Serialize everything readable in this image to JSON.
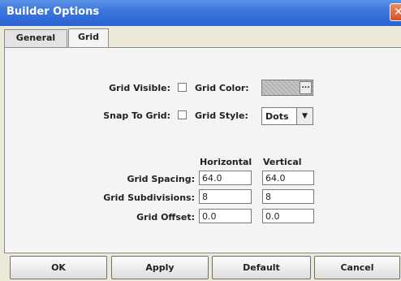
{
  "window": {
    "title": "Builder Options",
    "close_glyph": "✕"
  },
  "tabs": [
    {
      "label": "General",
      "selected": false
    },
    {
      "label": "Grid",
      "selected": true
    }
  ],
  "grid": {
    "visible_label": "Grid Visible:",
    "visible_checked": false,
    "color_label": "Grid Color:",
    "color_button": "...",
    "snap_label": "Snap To Grid:",
    "snap_checked": false,
    "style_label": "Grid Style:",
    "style_value": "Dots"
  },
  "table": {
    "col_horizontal": "Horizontal",
    "col_vertical": "Vertical",
    "rows": [
      {
        "label": "Grid Spacing:",
        "horizontal": "64.0",
        "vertical": "64.0"
      },
      {
        "label": "Grid Subdivisions:",
        "horizontal": "8",
        "vertical": "8"
      },
      {
        "label": "Grid Offset:",
        "horizontal": "0.0",
        "vertical": "0.0"
      }
    ]
  },
  "buttons": {
    "ok": "OK",
    "apply": "Apply",
    "default": "Default",
    "cancel": "Cancel"
  },
  "colors": {
    "title_bar": "#2a62d3",
    "close_button": "#d4502a",
    "background": "#ece9d8"
  }
}
